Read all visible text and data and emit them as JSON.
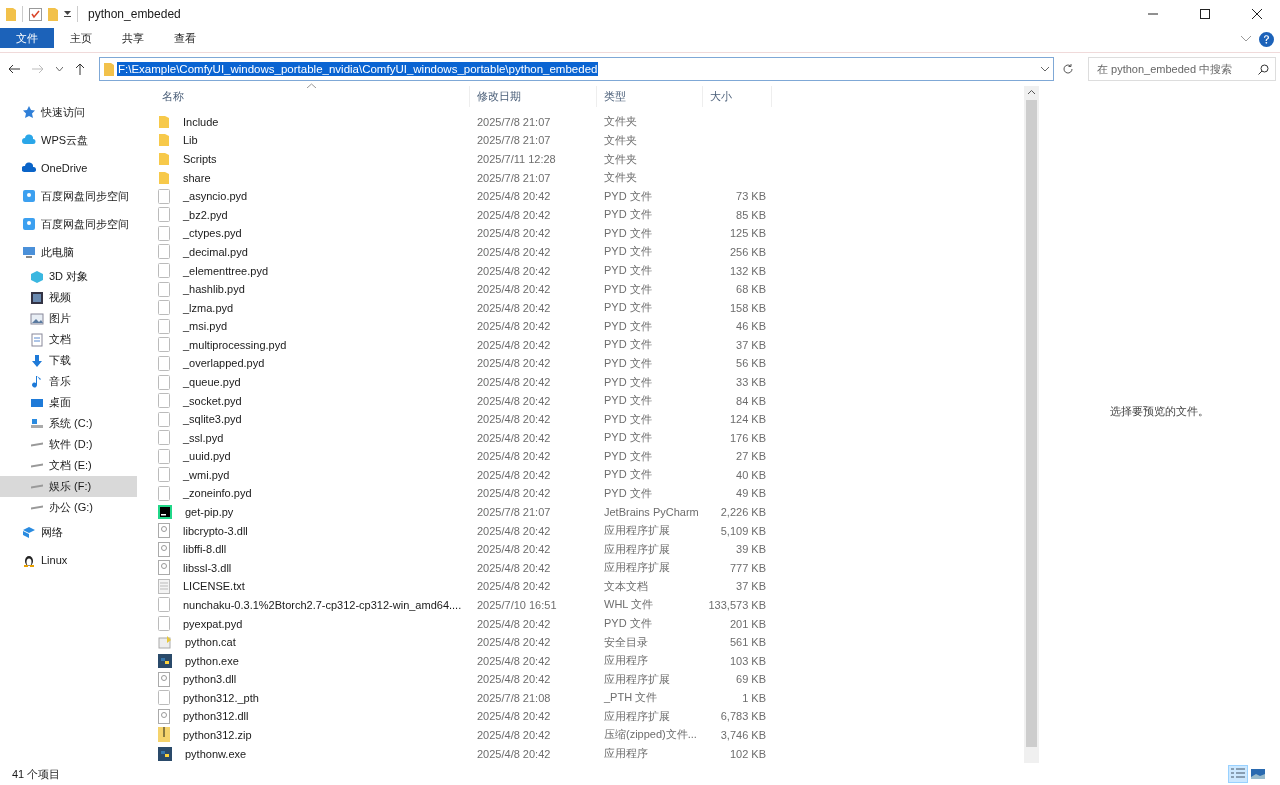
{
  "window": {
    "title": "python_embeded"
  },
  "ribbon": {
    "tabs": [
      {
        "label": "文件",
        "selected": true
      },
      {
        "label": "主页",
        "selected": false
      },
      {
        "label": "共享",
        "selected": false
      },
      {
        "label": "查看",
        "selected": false
      }
    ]
  },
  "address": {
    "path": "F:\\Example\\ComfyUI_windows_portable_nvidia\\ComfyUI_windows_portable\\python_embeded",
    "selected": true
  },
  "search": {
    "placeholder": "在 python_embeded 中搜索"
  },
  "sidebar": {
    "items": [
      {
        "label": "快速访问",
        "kind": "star",
        "selected": false
      },
      {
        "label": "WPS云盘",
        "kind": "cloud",
        "selected": false
      },
      {
        "label": "OneDrive",
        "kind": "onedrive",
        "selected": false
      },
      {
        "label": "百度网盘同步空间",
        "kind": "sync",
        "selected": false
      },
      {
        "label": "百度网盘同步空间",
        "kind": "sync",
        "selected": false
      },
      {
        "label": "此电脑",
        "kind": "pc",
        "selected": false,
        "children": [
          {
            "label": "3D 对象",
            "kind": "cube",
            "selected": false
          },
          {
            "label": "视频",
            "kind": "video",
            "selected": false
          },
          {
            "label": "图片",
            "kind": "image",
            "selected": false
          },
          {
            "label": "文档",
            "kind": "doc",
            "selected": false
          },
          {
            "label": "下载",
            "kind": "download",
            "selected": false
          },
          {
            "label": "音乐",
            "kind": "music",
            "selected": false
          },
          {
            "label": "桌面",
            "kind": "desktop",
            "selected": false
          },
          {
            "label": "系统 (C:)",
            "kind": "sysdrive",
            "selected": false
          },
          {
            "label": "软件 (D:)",
            "kind": "drive",
            "selected": false
          },
          {
            "label": "文档 (E:)",
            "kind": "drive",
            "selected": false
          },
          {
            "label": "娱乐 (F:)",
            "kind": "drive",
            "selected": true
          },
          {
            "label": "办公 (G:)",
            "kind": "drive",
            "selected": false
          }
        ]
      },
      {
        "label": "网络",
        "kind": "network",
        "selected": false
      },
      {
        "label": "Linux",
        "kind": "linux",
        "selected": false
      }
    ]
  },
  "table": {
    "columns": [
      "名称",
      "修改日期",
      "类型",
      "大小"
    ],
    "rows": [
      {
        "name": "Include",
        "date": "2025/7/8 21:07",
        "type": "文件夹",
        "kind": "folder"
      },
      {
        "name": "Lib",
        "date": "2025/7/8 21:07",
        "type": "文件夹",
        "kind": "folder"
      },
      {
        "name": "Scripts",
        "date": "2025/7/11 12:28",
        "type": "文件夹",
        "kind": "folder"
      },
      {
        "name": "share",
        "date": "2025/7/8 21:07",
        "type": "文件夹",
        "kind": "folder"
      },
      {
        "name": "_asyncio.pyd",
        "date": "2025/4/8 20:42",
        "type": "PYD 文件",
        "size": "73 KB",
        "kind": "file"
      },
      {
        "name": "_bz2.pyd",
        "date": "2025/4/8 20:42",
        "type": "PYD 文件",
        "size": "85 KB",
        "kind": "file"
      },
      {
        "name": "_ctypes.pyd",
        "date": "2025/4/8 20:42",
        "type": "PYD 文件",
        "size": "125 KB",
        "kind": "file"
      },
      {
        "name": "_decimal.pyd",
        "date": "2025/4/8 20:42",
        "type": "PYD 文件",
        "size": "256 KB",
        "kind": "file"
      },
      {
        "name": "_elementtree.pyd",
        "date": "2025/4/8 20:42",
        "type": "PYD 文件",
        "size": "132 KB",
        "kind": "file"
      },
      {
        "name": "_hashlib.pyd",
        "date": "2025/4/8 20:42",
        "type": "PYD 文件",
        "size": "68 KB",
        "kind": "file"
      },
      {
        "name": "_lzma.pyd",
        "date": "2025/4/8 20:42",
        "type": "PYD 文件",
        "size": "158 KB",
        "kind": "file"
      },
      {
        "name": "_msi.pyd",
        "date": "2025/4/8 20:42",
        "type": "PYD 文件",
        "size": "46 KB",
        "kind": "file"
      },
      {
        "name": "_multiprocessing.pyd",
        "date": "2025/4/8 20:42",
        "type": "PYD 文件",
        "size": "37 KB",
        "kind": "file"
      },
      {
        "name": "_overlapped.pyd",
        "date": "2025/4/8 20:42",
        "type": "PYD 文件",
        "size": "56 KB",
        "kind": "file"
      },
      {
        "name": "_queue.pyd",
        "date": "2025/4/8 20:42",
        "type": "PYD 文件",
        "size": "33 KB",
        "kind": "file"
      },
      {
        "name": "_socket.pyd",
        "date": "2025/4/8 20:42",
        "type": "PYD 文件",
        "size": "84 KB",
        "kind": "file"
      },
      {
        "name": "_sqlite3.pyd",
        "date": "2025/4/8 20:42",
        "type": "PYD 文件",
        "size": "124 KB",
        "kind": "file"
      },
      {
        "name": "_ssl.pyd",
        "date": "2025/4/8 20:42",
        "type": "PYD 文件",
        "size": "176 KB",
        "kind": "file"
      },
      {
        "name": "_uuid.pyd",
        "date": "2025/4/8 20:42",
        "type": "PYD 文件",
        "size": "27 KB",
        "kind": "file"
      },
      {
        "name": "_wmi.pyd",
        "date": "2025/4/8 20:42",
        "type": "PYD 文件",
        "size": "40 KB",
        "kind": "file"
      },
      {
        "name": "_zoneinfo.pyd",
        "date": "2025/4/8 20:42",
        "type": "PYD 文件",
        "size": "49 KB",
        "kind": "file"
      },
      {
        "name": "get-pip.py",
        "date": "2025/7/8 21:07",
        "type": "JetBrains PyCharm",
        "size": "2,226 KB",
        "kind": "pycharm"
      },
      {
        "name": "libcrypto-3.dll",
        "date": "2025/4/8 20:42",
        "type": "应用程序扩展",
        "size": "5,109 KB",
        "kind": "dll"
      },
      {
        "name": "libffi-8.dll",
        "date": "2025/4/8 20:42",
        "type": "应用程序扩展",
        "size": "39 KB",
        "kind": "dll"
      },
      {
        "name": "libssl-3.dll",
        "date": "2025/4/8 20:42",
        "type": "应用程序扩展",
        "size": "777 KB",
        "kind": "dll"
      },
      {
        "name": "LICENSE.txt",
        "date": "2025/4/8 20:42",
        "type": "文本文档",
        "size": "37 KB",
        "kind": "text"
      },
      {
        "name": "nunchaku-0.3.1%2Btorch2.7-cp312-cp312-win_amd64....",
        "date": "2025/7/10 16:51",
        "type": "WHL 文件",
        "size": "133,573 KB",
        "kind": "file"
      },
      {
        "name": "pyexpat.pyd",
        "date": "2025/4/8 20:42",
        "type": "PYD 文件",
        "size": "201 KB",
        "kind": "file"
      },
      {
        "name": "python.cat",
        "date": "2025/4/8 20:42",
        "type": "安全目录",
        "size": "561 KB",
        "kind": "catalog"
      },
      {
        "name": "python.exe",
        "date": "2025/4/8 20:42",
        "type": "应用程序",
        "size": "103 KB",
        "kind": "exe"
      },
      {
        "name": "python3.dll",
        "date": "2025/4/8 20:42",
        "type": "应用程序扩展",
        "size": "69 KB",
        "kind": "dll"
      },
      {
        "name": "python312._pth",
        "date": "2025/7/8 21:08",
        "type": "_PTH 文件",
        "size": "1 KB",
        "kind": "file"
      },
      {
        "name": "python312.dll",
        "date": "2025/4/8 20:42",
        "type": "应用程序扩展",
        "size": "6,783 KB",
        "kind": "dll"
      },
      {
        "name": "python312.zip",
        "date": "2025/4/8 20:42",
        "type": "压缩(zipped)文件...",
        "size": "3,746 KB",
        "kind": "zip"
      },
      {
        "name": "pythonw.exe",
        "date": "2025/4/8 20:42",
        "type": "应用程序",
        "size": "102 KB",
        "kind": "exe"
      }
    ]
  },
  "preview": {
    "message": "选择要预览的文件。"
  },
  "status_bar": {
    "count": "41 个项目",
    "views": [
      {
        "kind": "details",
        "selected": true
      },
      {
        "kind": "large-icons",
        "selected": false
      }
    ]
  }
}
